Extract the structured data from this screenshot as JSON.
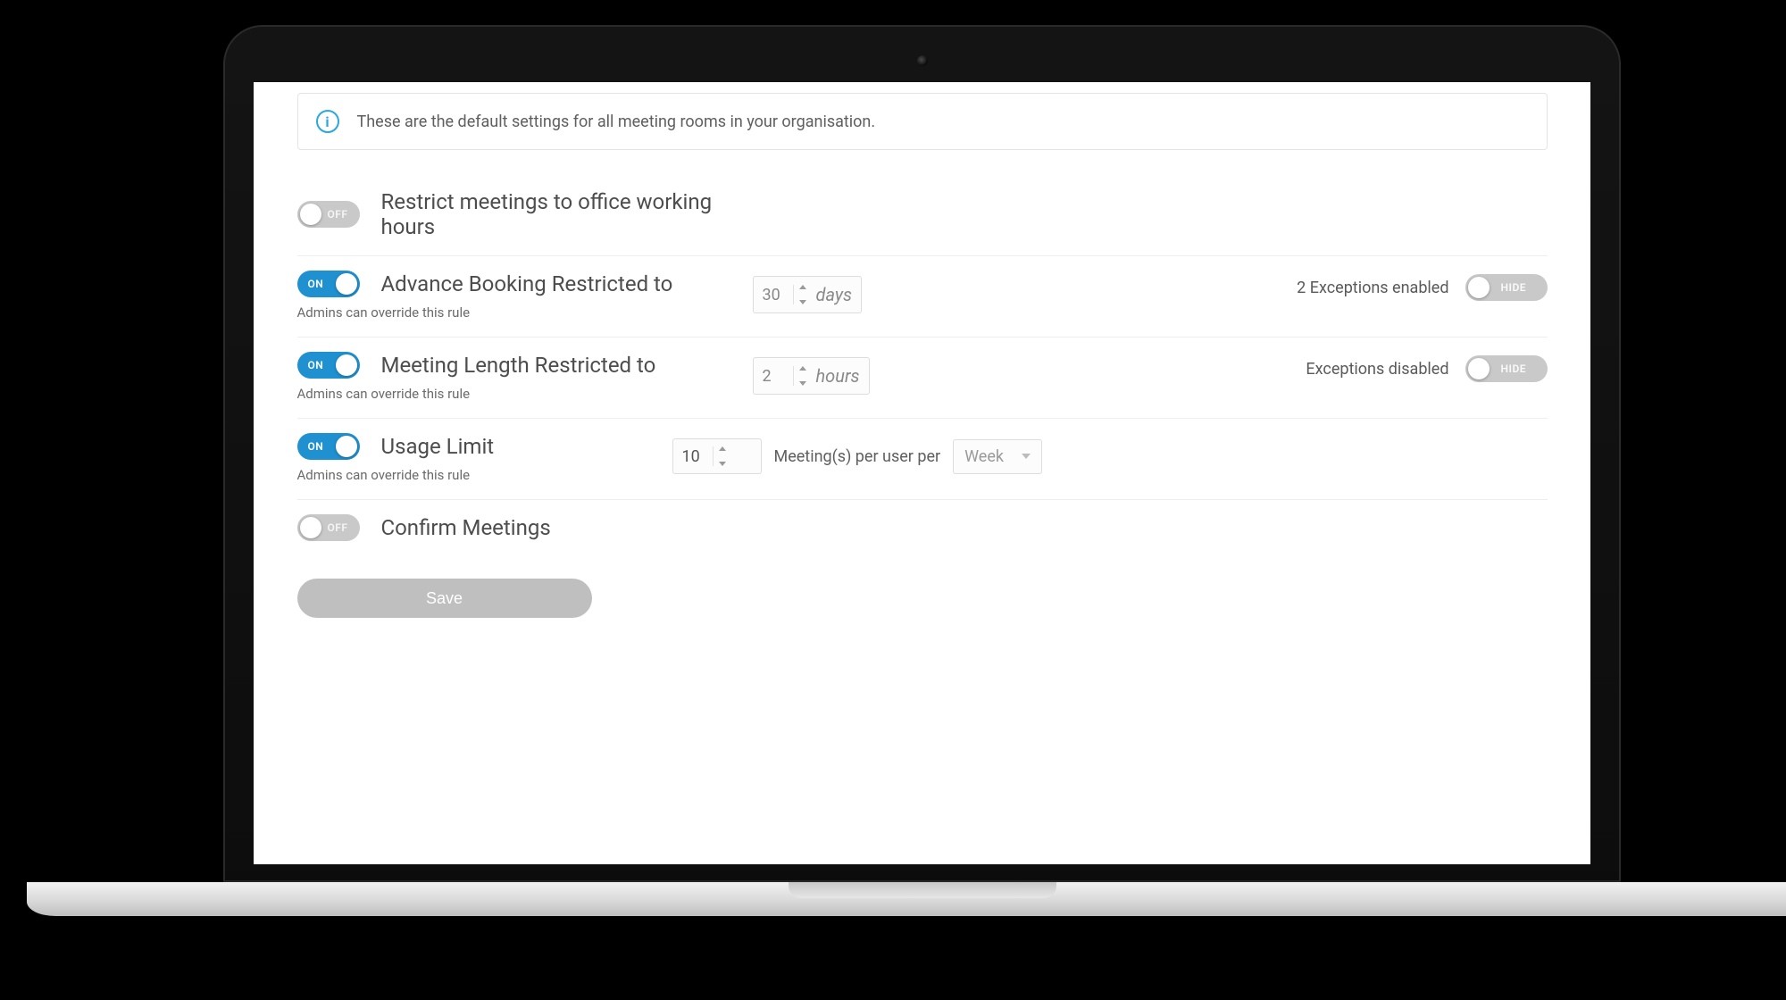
{
  "info_banner": "These are the default settings for all meeting rooms in your organisation.",
  "toggle_labels": {
    "on": "ON",
    "off": "OFF",
    "hide": "HIDE"
  },
  "rules": {
    "restrict_hours": {
      "title": "Restrict meetings to office working hours",
      "enabled": false
    },
    "advance_booking": {
      "title": "Advance Booking Restricted to",
      "enabled": true,
      "sub": "Admins can override this rule",
      "value": "30",
      "unit": "days",
      "exceptions_text": "2 Exceptions enabled",
      "exceptions_toggle": "HIDE"
    },
    "meeting_length": {
      "title": "Meeting Length Restricted to",
      "enabled": true,
      "sub": "Admins can override this rule",
      "value": "2",
      "unit": "hours",
      "exceptions_text": "Exceptions disabled",
      "exceptions_toggle": "HIDE"
    },
    "usage_limit": {
      "title": "Usage Limit",
      "enabled": true,
      "sub": "Admins can override this rule",
      "value": "10",
      "mid_label": "Meeting(s) per user per",
      "period": "Week"
    },
    "confirm_meetings": {
      "title": "Confirm Meetings",
      "enabled": false
    }
  },
  "save_label": "Save"
}
